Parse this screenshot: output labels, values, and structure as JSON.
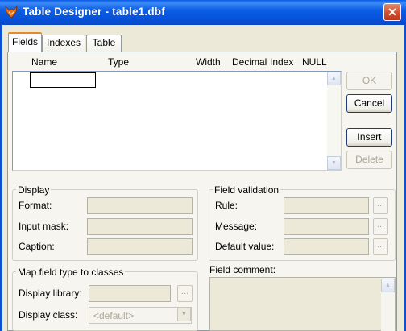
{
  "window": {
    "title": "Table Designer - table1.dbf"
  },
  "tabs": [
    {
      "label": "Fields",
      "active": true
    },
    {
      "label": "Indexes",
      "active": false
    },
    {
      "label": "Table",
      "active": false
    }
  ],
  "grid": {
    "columns": [
      "Name",
      "Type",
      "Width",
      "Decimal",
      "Index",
      "NULL"
    ],
    "name_value": ""
  },
  "buttons": {
    "ok": {
      "label": "OK",
      "enabled": false
    },
    "cancel": {
      "label": "Cancel",
      "enabled": true
    },
    "insert": {
      "label": "Insert",
      "enabled": true
    },
    "delete": {
      "label": "Delete",
      "enabled": false
    }
  },
  "display_group": {
    "legend": "Display",
    "format": {
      "label": "Format:",
      "value": ""
    },
    "input_mask": {
      "label": "Input mask:",
      "value": ""
    },
    "caption": {
      "label": "Caption:",
      "value": ""
    }
  },
  "validation_group": {
    "legend": "Field validation",
    "rule": {
      "label": "Rule:",
      "value": ""
    },
    "message": {
      "label": "Message:",
      "value": ""
    },
    "default_value": {
      "label": "Default value:",
      "value": ""
    },
    "browse_label": "..."
  },
  "map_group": {
    "legend": "Map field type to classes",
    "display_library": {
      "label": "Display library:",
      "value": ""
    },
    "display_class": {
      "label": "Display class:",
      "value": "<default>"
    },
    "browse_label": "..."
  },
  "field_comment": {
    "label": "Field comment:",
    "value": ""
  },
  "colors": {
    "title_bar": "#0a5ae6",
    "close_button": "#d14f2c",
    "active_tab_accent": "#e68b2c",
    "dialog_bg": "#ece9d8"
  },
  "icons": {
    "app": "fox-icon",
    "close": "close-icon",
    "scroll_up": "arrow-up-icon",
    "scroll_down": "arrow-down-icon",
    "dropdown": "chevron-down-icon"
  }
}
